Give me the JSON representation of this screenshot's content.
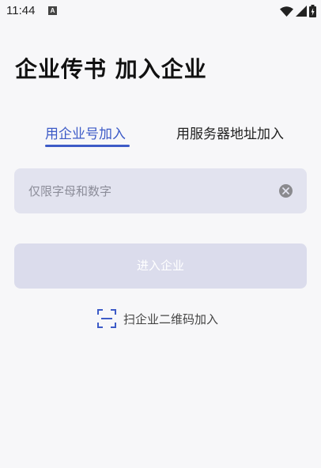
{
  "status_bar": {
    "time": "11:44",
    "notification_icon_letter": "A"
  },
  "header": {
    "title": "企业传书 加入企业"
  },
  "tabs": [
    {
      "label": "用企业号加入",
      "active": true
    },
    {
      "label": "用服务器地址加入",
      "active": false
    }
  ],
  "form": {
    "input_value": "",
    "input_placeholder": "仅限字母和数字",
    "submit_label": "进入企业"
  },
  "qr": {
    "label": "扫企业二维码加入",
    "icon": "qr-scan-icon"
  },
  "colors": {
    "accent": "#3d5bc7",
    "input_bg": "#e2e3ef",
    "button_bg": "#dbdcec",
    "page_bg": "#f7f7f9"
  }
}
